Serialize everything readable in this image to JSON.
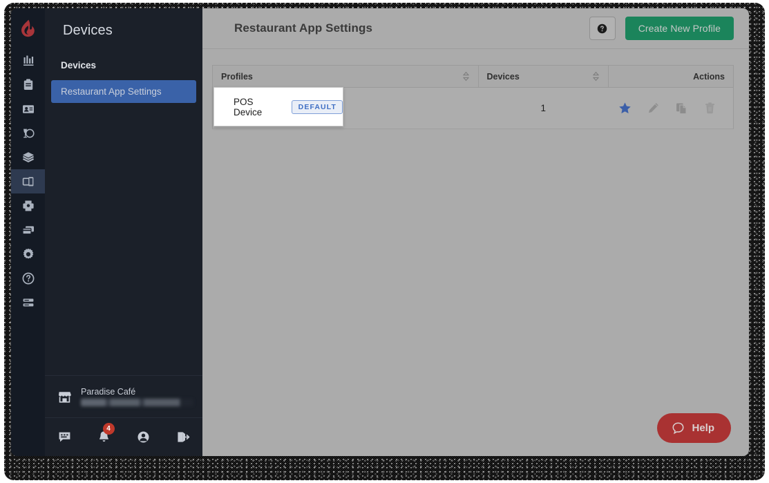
{
  "app": {
    "logo_icon": "lightspeed-flame-logo"
  },
  "rail": {
    "items": [
      {
        "name": "reports",
        "icon": "bar-chart-icon"
      },
      {
        "name": "inventory",
        "icon": "clipboard-icon"
      },
      {
        "name": "customers",
        "icon": "id-card-icon"
      },
      {
        "name": "restaurant",
        "icon": "wine-glass-plate-icon"
      },
      {
        "name": "products",
        "icon": "layers-icon"
      },
      {
        "name": "devices",
        "icon": "devices-icon",
        "active": true
      },
      {
        "name": "printers",
        "icon": "printer-icon"
      },
      {
        "name": "payments",
        "icon": "payment-cards-icon"
      },
      {
        "name": "settings",
        "icon": "gear-icon"
      },
      {
        "name": "help",
        "icon": "question-circle-icon"
      },
      {
        "name": "more",
        "icon": "list-lines-icon"
      }
    ]
  },
  "sidebar": {
    "title": "Devices",
    "nav": [
      {
        "label": "Devices",
        "active": false
      },
      {
        "label": "Restaurant App Settings",
        "active": true
      }
    ],
    "shop": {
      "icon": "storefront-icon",
      "name": "Paradise Café",
      "subtitle_redacted": true
    },
    "footer": [
      {
        "name": "messages",
        "icon": "chat-icon",
        "badge": ""
      },
      {
        "name": "notifications",
        "icon": "bell-icon",
        "badge": "4"
      },
      {
        "name": "account",
        "icon": "user-circle-icon",
        "badge": ""
      },
      {
        "name": "logout",
        "icon": "logout-icon",
        "badge": ""
      }
    ]
  },
  "main": {
    "page_title": "Restaurant App Settings",
    "header": {
      "help_icon": "question-mark-icon",
      "create_button": "Create New Profile"
    },
    "table": {
      "columns": [
        {
          "label": "Profiles",
          "sortable": true,
          "align": "left"
        },
        {
          "label": "Devices",
          "sortable": true,
          "align": "left"
        },
        {
          "label": "Actions",
          "sortable": false,
          "align": "right"
        }
      ],
      "rows": [
        {
          "profile": "POS Device",
          "badge": "DEFAULT",
          "devices": "1",
          "actions": [
            {
              "name": "set-default",
              "icon": "star-icon",
              "state": "active"
            },
            {
              "name": "edit",
              "icon": "pencil-icon",
              "state": "normal"
            },
            {
              "name": "duplicate",
              "icon": "copy-icon",
              "state": "normal"
            },
            {
              "name": "delete",
              "icon": "trash-icon",
              "state": "disabled"
            }
          ]
        }
      ]
    },
    "spotlight": {
      "profile": "POS Device",
      "badge": "DEFAULT"
    },
    "help_widget": {
      "label": "Help",
      "icon": "chat-bubble-icon"
    }
  },
  "colors": {
    "rail_bg": "#141a24",
    "sidebar_bg": "#1b2029",
    "nav_active": "#3a62a8",
    "rail_active": "#2e3a50",
    "brand_red": "#a8353a",
    "create_green": "#1b845b",
    "badge_red": "#c0392b",
    "star_blue": "#3c5fa8",
    "default_badge_blue": "#3f6fc4",
    "help_pill": "#a93232",
    "overlay_gray": "#ababab"
  }
}
